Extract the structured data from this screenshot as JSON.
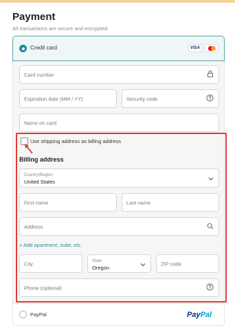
{
  "header": {
    "title": "Payment",
    "subtitle": "All transactions are secure and encrypted."
  },
  "payment_methods": {
    "credit_card": {
      "label": "Credit card",
      "selected": true,
      "card_brands": [
        "VISA",
        "mastercard-icon"
      ],
      "fields": {
        "card_number": {
          "placeholder": "Card number",
          "icon": "lock-icon"
        },
        "expiration": {
          "placeholder": "Expiration date (MM / YY)"
        },
        "security_code": {
          "placeholder": "Security code",
          "icon": "help-icon"
        },
        "name_on_card": {
          "placeholder": "Name on card"
        }
      }
    },
    "paypal": {
      "label": "PayPal",
      "selected": false,
      "logo_part1": "Pay",
      "logo_part2": "Pal"
    }
  },
  "billing": {
    "same_as_shipping_label": "Use shipping address as billing address",
    "same_as_shipping_checked": false,
    "heading": "Billing address",
    "country": {
      "label": "Country/Region",
      "value": "United States"
    },
    "first_name": {
      "placeholder": "First name"
    },
    "last_name": {
      "placeholder": "Last name"
    },
    "address": {
      "placeholder": "Address",
      "icon": "search-icon"
    },
    "add_apartment": "+ Add apartment, suite, etc.",
    "city": {
      "placeholder": "City"
    },
    "state": {
      "label": "State",
      "value": "Oregon"
    },
    "zip": {
      "placeholder": "ZIP code"
    },
    "phone": {
      "placeholder": "Phone (optional)",
      "icon": "help-icon"
    }
  },
  "colors": {
    "accent": "#1e8c92",
    "highlight_border": "#e23b35",
    "selected_panel_bg": "#eef6f6"
  }
}
